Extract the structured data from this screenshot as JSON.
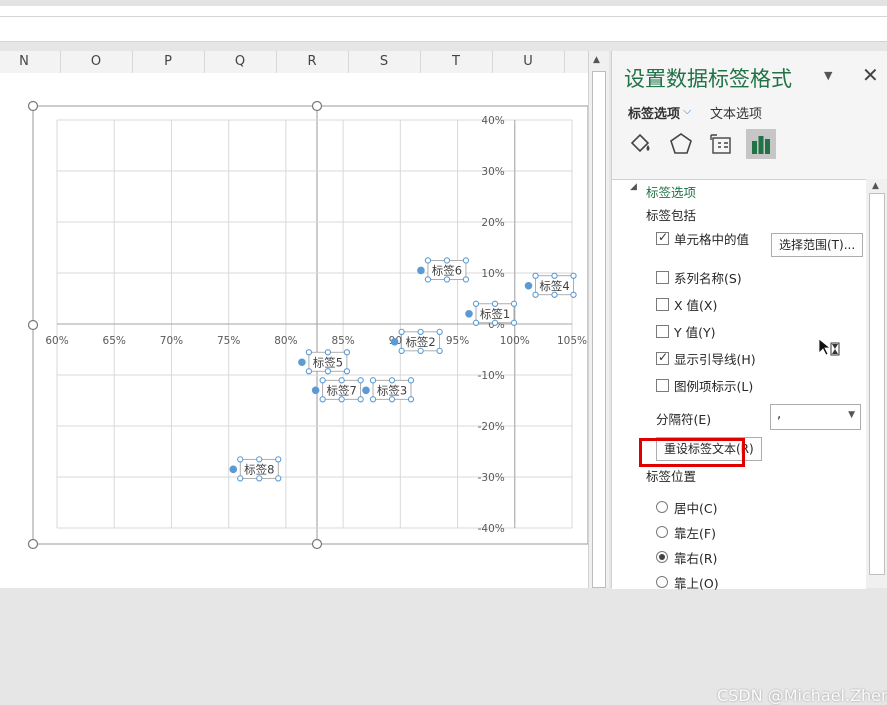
{
  "sheet": {
    "columns": [
      "N",
      "O",
      "P",
      "Q",
      "R",
      "S",
      "T",
      "U"
    ]
  },
  "chart_data": {
    "type": "scatter",
    "x_ticks": [
      "60%",
      "65%",
      "70%",
      "75%",
      "80%",
      "85%",
      "90%",
      "95%",
      "100%",
      "105%"
    ],
    "y_ticks": [
      "40%",
      "30%",
      "20%",
      "10%",
      "0%",
      "-10%",
      "-20%",
      "-30%",
      "-40%"
    ],
    "xlim": [
      0.6,
      1.05
    ],
    "ylim": [
      -0.4,
      0.4
    ],
    "grid": true,
    "points": [
      {
        "label": "标签1",
        "x": 0.96,
        "y": 0.02
      },
      {
        "label": "标签2",
        "x": 0.895,
        "y": -0.035
      },
      {
        "label": "标签3",
        "x": 0.87,
        "y": -0.13
      },
      {
        "label": "标签4",
        "x": 1.012,
        "y": 0.075
      },
      {
        "label": "标签5",
        "x": 0.814,
        "y": -0.075
      },
      {
        "label": "标签6",
        "x": 0.918,
        "y": 0.105
      },
      {
        "label": "标签7",
        "x": 0.826,
        "y": -0.13
      },
      {
        "label": "标签8",
        "x": 0.754,
        "y": -0.285
      }
    ],
    "point_color": "#5b9bd5"
  },
  "pane": {
    "title": "设置数据标签格式",
    "tab_label_options": "标签选项",
    "tab_text_options": "文本选项",
    "icons": [
      "paint-bucket-icon",
      "pentagon-icon",
      "size-properties-icon",
      "bar-chart-icon"
    ],
    "section_title": "标签选项",
    "label_contains": "标签包括",
    "chk_cell_value": "单元格中的值",
    "btn_select_range": "选择范围(T)...",
    "chk_series_name": "系列名称(S)",
    "chk_x_value": "X 值(X)",
    "chk_y_value": "Y 值(Y)",
    "chk_leader_lines": "显示引导线(H)",
    "chk_legend_key": "图例项标示(L)",
    "separator_label": "分隔符(E)",
    "separator_value": ",",
    "btn_reset": "重设标签文本(R)",
    "label_position": "标签位置",
    "pos_center": "居中(C)",
    "pos_left": "靠左(F)",
    "pos_right": "靠右(R)",
    "pos_above": "靠上(O)",
    "highlight_color": "#e00000",
    "accent_color": "#217346"
  },
  "watermark": "CSDN @Michael.Zheng"
}
